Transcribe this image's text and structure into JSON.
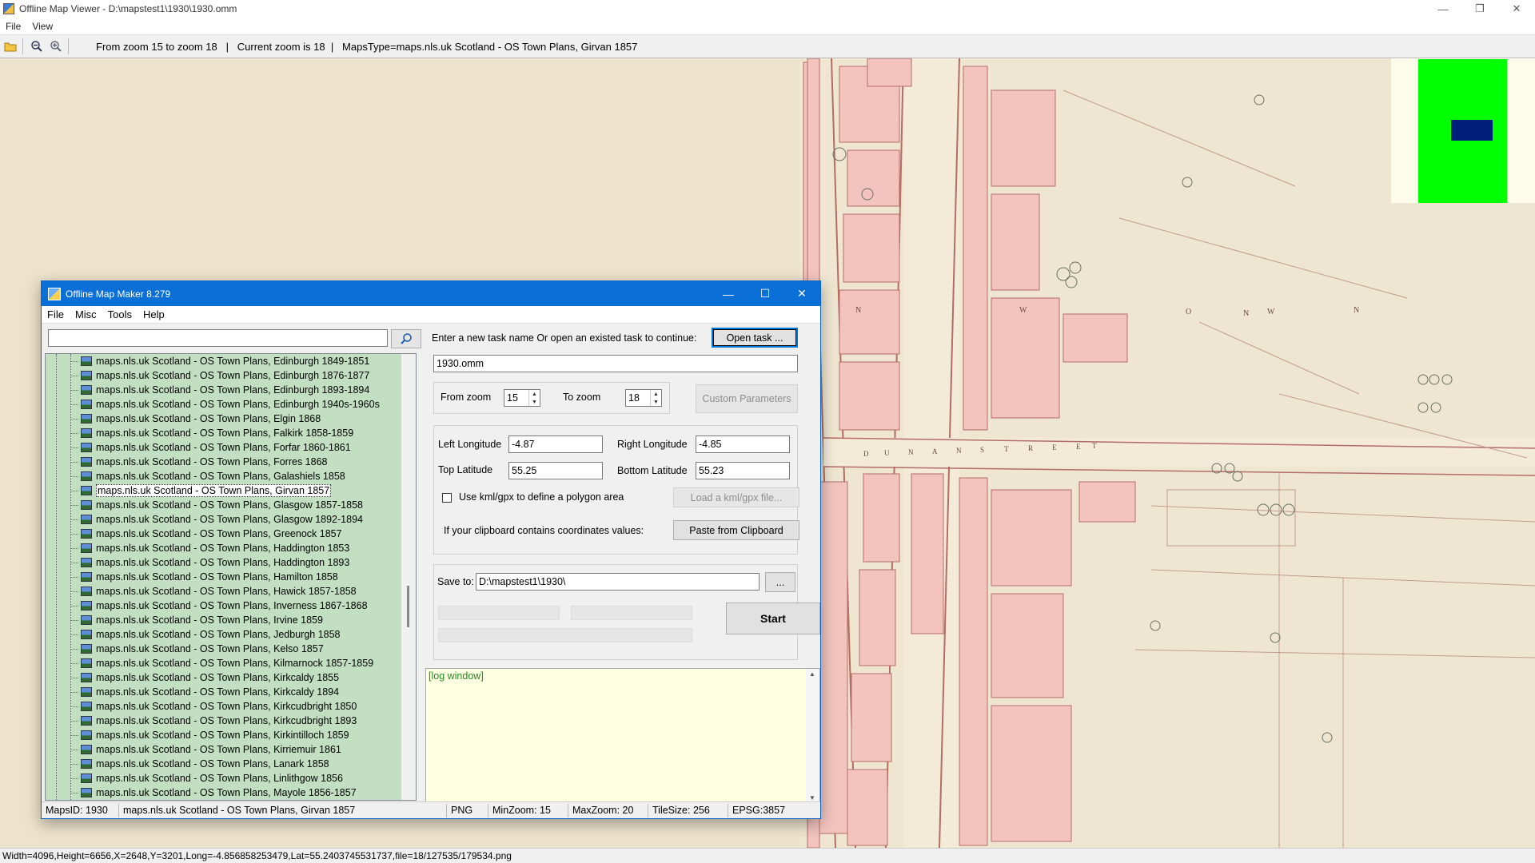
{
  "outer_window": {
    "title": "Offline Map Viewer - D:\\mapstest1\\1930\\1930.omm",
    "controls": {
      "minimize": "—",
      "restore": "❐",
      "close": "✕"
    },
    "menu": [
      "File",
      "View"
    ],
    "toolbar": {
      "info_text": "From zoom 15 to zoom 18   |   Current zoom is 18  |   MapsType=maps.nls.uk Scotland - OS Town Plans, Girvan 1857"
    },
    "status_text": "Width=4096,Height=6656,X=2648,Y=3201,Long=-4.856858253479,Lat=55.2403745531737,file=18/127535/179534.png"
  },
  "map": {
    "street_letters": [
      "D",
      "U",
      "N",
      "A",
      "N",
      "S",
      "T",
      "R",
      "E",
      "E",
      "T"
    ],
    "labels": [
      "N",
      "W",
      "O",
      "N",
      "N",
      "W"
    ],
    "colors": {
      "background": "#efe6d1",
      "building": "#f2c4bd",
      "outline": "#b46c64",
      "overview_green": "#00ff00",
      "overview_blue": "#001f7a"
    }
  },
  "dialog": {
    "title": "Offline Map Maker 8.279",
    "controls": {
      "minimize": "—",
      "maximize": "☐",
      "close": "✕"
    },
    "menu": [
      "File",
      "Misc",
      "Tools",
      "Help"
    ],
    "search": {
      "value": "",
      "placeholder": ""
    },
    "map_list": [
      "maps.nls.uk Scotland - OS Town Plans, Edinburgh 1849-1851",
      "maps.nls.uk Scotland - OS Town Plans, Edinburgh 1876-1877",
      "maps.nls.uk Scotland - OS Town Plans, Edinburgh 1893-1894",
      "maps.nls.uk Scotland - OS Town Plans, Edinburgh 1940s-1960s",
      "maps.nls.uk Scotland - OS Town Plans, Elgin 1868",
      "maps.nls.uk Scotland - OS Town Plans, Falkirk 1858-1859",
      "maps.nls.uk Scotland - OS Town Plans, Forfar 1860-1861",
      "maps.nls.uk Scotland - OS Town Plans, Forres 1868",
      "maps.nls.uk Scotland - OS Town Plans, Galashiels 1858",
      "maps.nls.uk Scotland - OS Town Plans, Girvan 1857",
      "maps.nls.uk Scotland - OS Town Plans, Glasgow 1857-1858",
      "maps.nls.uk Scotland - OS Town Plans, Glasgow 1892-1894",
      "maps.nls.uk Scotland - OS Town Plans, Greenock 1857",
      "maps.nls.uk Scotland - OS Town Plans, Haddington 1853",
      "maps.nls.uk Scotland - OS Town Plans, Haddington 1893",
      "maps.nls.uk Scotland - OS Town Plans, Hamilton 1858",
      "maps.nls.uk Scotland - OS Town Plans, Hawick 1857-1858",
      "maps.nls.uk Scotland - OS Town Plans, Inverness 1867-1868",
      "maps.nls.uk Scotland - OS Town Plans, Irvine 1859",
      "maps.nls.uk Scotland - OS Town Plans, Jedburgh 1858",
      "maps.nls.uk Scotland - OS Town Plans, Kelso 1857",
      "maps.nls.uk Scotland - OS Town Plans, Kilmarnock 1857-1859",
      "maps.nls.uk Scotland - OS Town Plans, Kirkcaldy 1855",
      "maps.nls.uk Scotland - OS Town Plans, Kirkcaldy 1894",
      "maps.nls.uk Scotland - OS Town Plans, Kirkcudbright 1850",
      "maps.nls.uk Scotland - OS Town Plans, Kirkcudbright 1893",
      "maps.nls.uk Scotland - OS Town Plans, Kirkintilloch 1859",
      "maps.nls.uk Scotland - OS Town Plans, Kirriemuir 1861",
      "maps.nls.uk Scotland - OS Town Plans, Lanark 1858",
      "maps.nls.uk Scotland - OS Town Plans, Linlithgow 1856",
      "maps.nls.uk Scotland - OS Town Plans, Mayole 1856-1857"
    ],
    "selected_map": "maps.nls.uk Scotland - OS Town Plans, Girvan 1857",
    "task": {
      "prompt": "Enter a new task name Or open an existed task to continue:",
      "open_button": "Open task ...",
      "name_value": "1930.omm"
    },
    "zoom": {
      "from_label": "From zoom",
      "from_value": "15",
      "to_label": "To zoom",
      "to_value": "18",
      "custom_button": "Custom Parameters"
    },
    "coords": {
      "left_lon_label": "Left Longitude",
      "left_lon_value": "-4.87",
      "right_lon_label": "Right Longitude",
      "right_lon_value": "-4.85",
      "top_lat_label": "Top Latitude",
      "top_lat_value": "55.25",
      "bottom_lat_label": "Bottom Latitude",
      "bottom_lat_value": "55.23",
      "kml_label": "Use kml/gpx to define a polygon area",
      "kml_checked": false,
      "kml_button": "Load a kml/gpx file...",
      "clipboard_label": "If your clipboard contains coordinates values:",
      "clipboard_button": "Paste from Clipboard"
    },
    "save": {
      "label": "Save to:",
      "value": "D:\\mapstest1\\1930\\",
      "browse_button": "..."
    },
    "start_button": "Start",
    "progress": [
      0,
      0,
      0
    ],
    "log_text": "[log window]",
    "status": {
      "maps_id": "MapsID: 1930",
      "map_name": "maps.nls.uk Scotland - OS Town Plans, Girvan 1857",
      "format": "PNG",
      "min_zoom": "MinZoom: 15",
      "max_zoom": "MaxZoom: 20",
      "tile_size": "TileSize: 256",
      "epsg": "EPSG:3857"
    }
  }
}
